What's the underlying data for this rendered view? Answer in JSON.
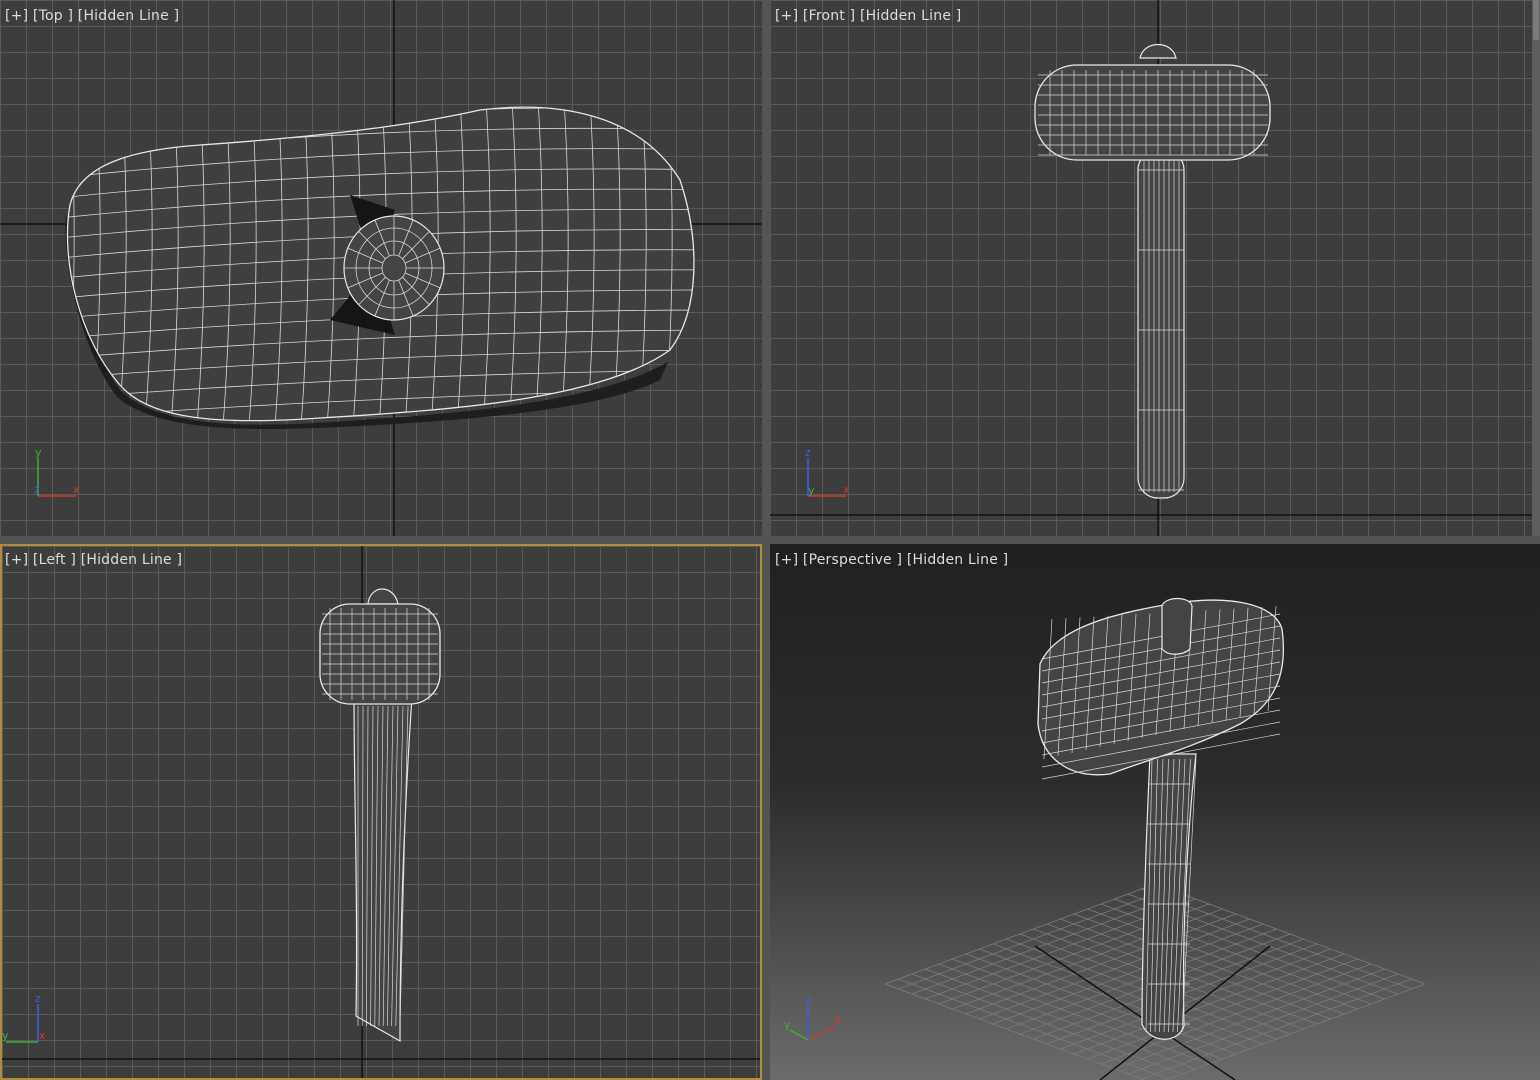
{
  "viewports": {
    "top": {
      "plus": "[+]",
      "view": "[Top ]",
      "shading": "[Hidden Line ]"
    },
    "front": {
      "plus": "[+]",
      "view": "[Front ]",
      "shading": "[Hidden Line ]"
    },
    "left": {
      "plus": "[+]",
      "view": "[Left ]",
      "shading": "[Hidden Line ]",
      "active": true
    },
    "perspective": {
      "plus": "[+]",
      "view": "[Perspective ]",
      "shading": "[Hidden Line ]"
    }
  },
  "axis_labels": {
    "top": {
      "a": "y",
      "b": "z",
      "c": "x"
    },
    "front": {
      "a": "z",
      "b": "y",
      "c": "x"
    },
    "left": {
      "a": "z",
      "b": "y",
      "c": "x"
    },
    "perspective": {
      "a": "z",
      "b": "y",
      "c": "x"
    }
  },
  "colors": {
    "active_border": "#b08d3c",
    "axis_x": "#d23a2a",
    "axis_y": "#3fae3f",
    "axis_z": "#3a5fe0",
    "wire": "#e8e8e8"
  },
  "object": "mallet-hammer-model"
}
